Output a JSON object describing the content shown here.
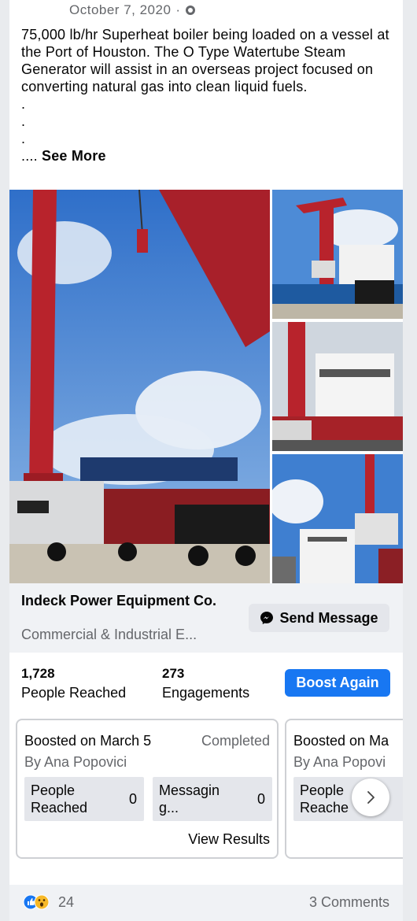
{
  "post": {
    "date": "October 7, 2020",
    "privacy_icon": "globe-icon",
    "text": "75,000 lb/hr Superheat boiler being loaded on a vessel at the Port of Houston. The O Type Watertube Steam Generator will assist in an overseas project focused on converting natural gas into clean liquid fuels.\n.\n.\n.\n",
    "text_tail": "....",
    "see_more": "See More"
  },
  "page": {
    "name": "Indeck Power Equipment Co.",
    "category": "Commercial & Industrial E...",
    "send_message": "Send Message",
    "messenger_icon": "messenger-icon"
  },
  "stats": {
    "reached_value": "1,728",
    "reached_label": "People Reached",
    "engagements_value": "273",
    "engagements_label": "Engagements",
    "boost_again": "Boost Again"
  },
  "boosts": [
    {
      "title": "Boosted on March 5",
      "status": "Completed",
      "by": "By Ana Popovici",
      "metric1_label": "People\nReached",
      "metric1_value": "0",
      "metric2_label": "Messagin\ng...",
      "metric2_value": "0",
      "link": "View Results"
    },
    {
      "title": "Boosted on Ma",
      "by": "By Ana Popovi",
      "metric1_label": "People\nReache"
    }
  ],
  "reactions": {
    "icons": [
      "like-icon",
      "wow-icon"
    ],
    "count": "24",
    "comments": "3 Comments"
  },
  "colors": {
    "accent": "#1877f2",
    "secondary_text": "#65676b",
    "surface": "#f0f2f5"
  }
}
